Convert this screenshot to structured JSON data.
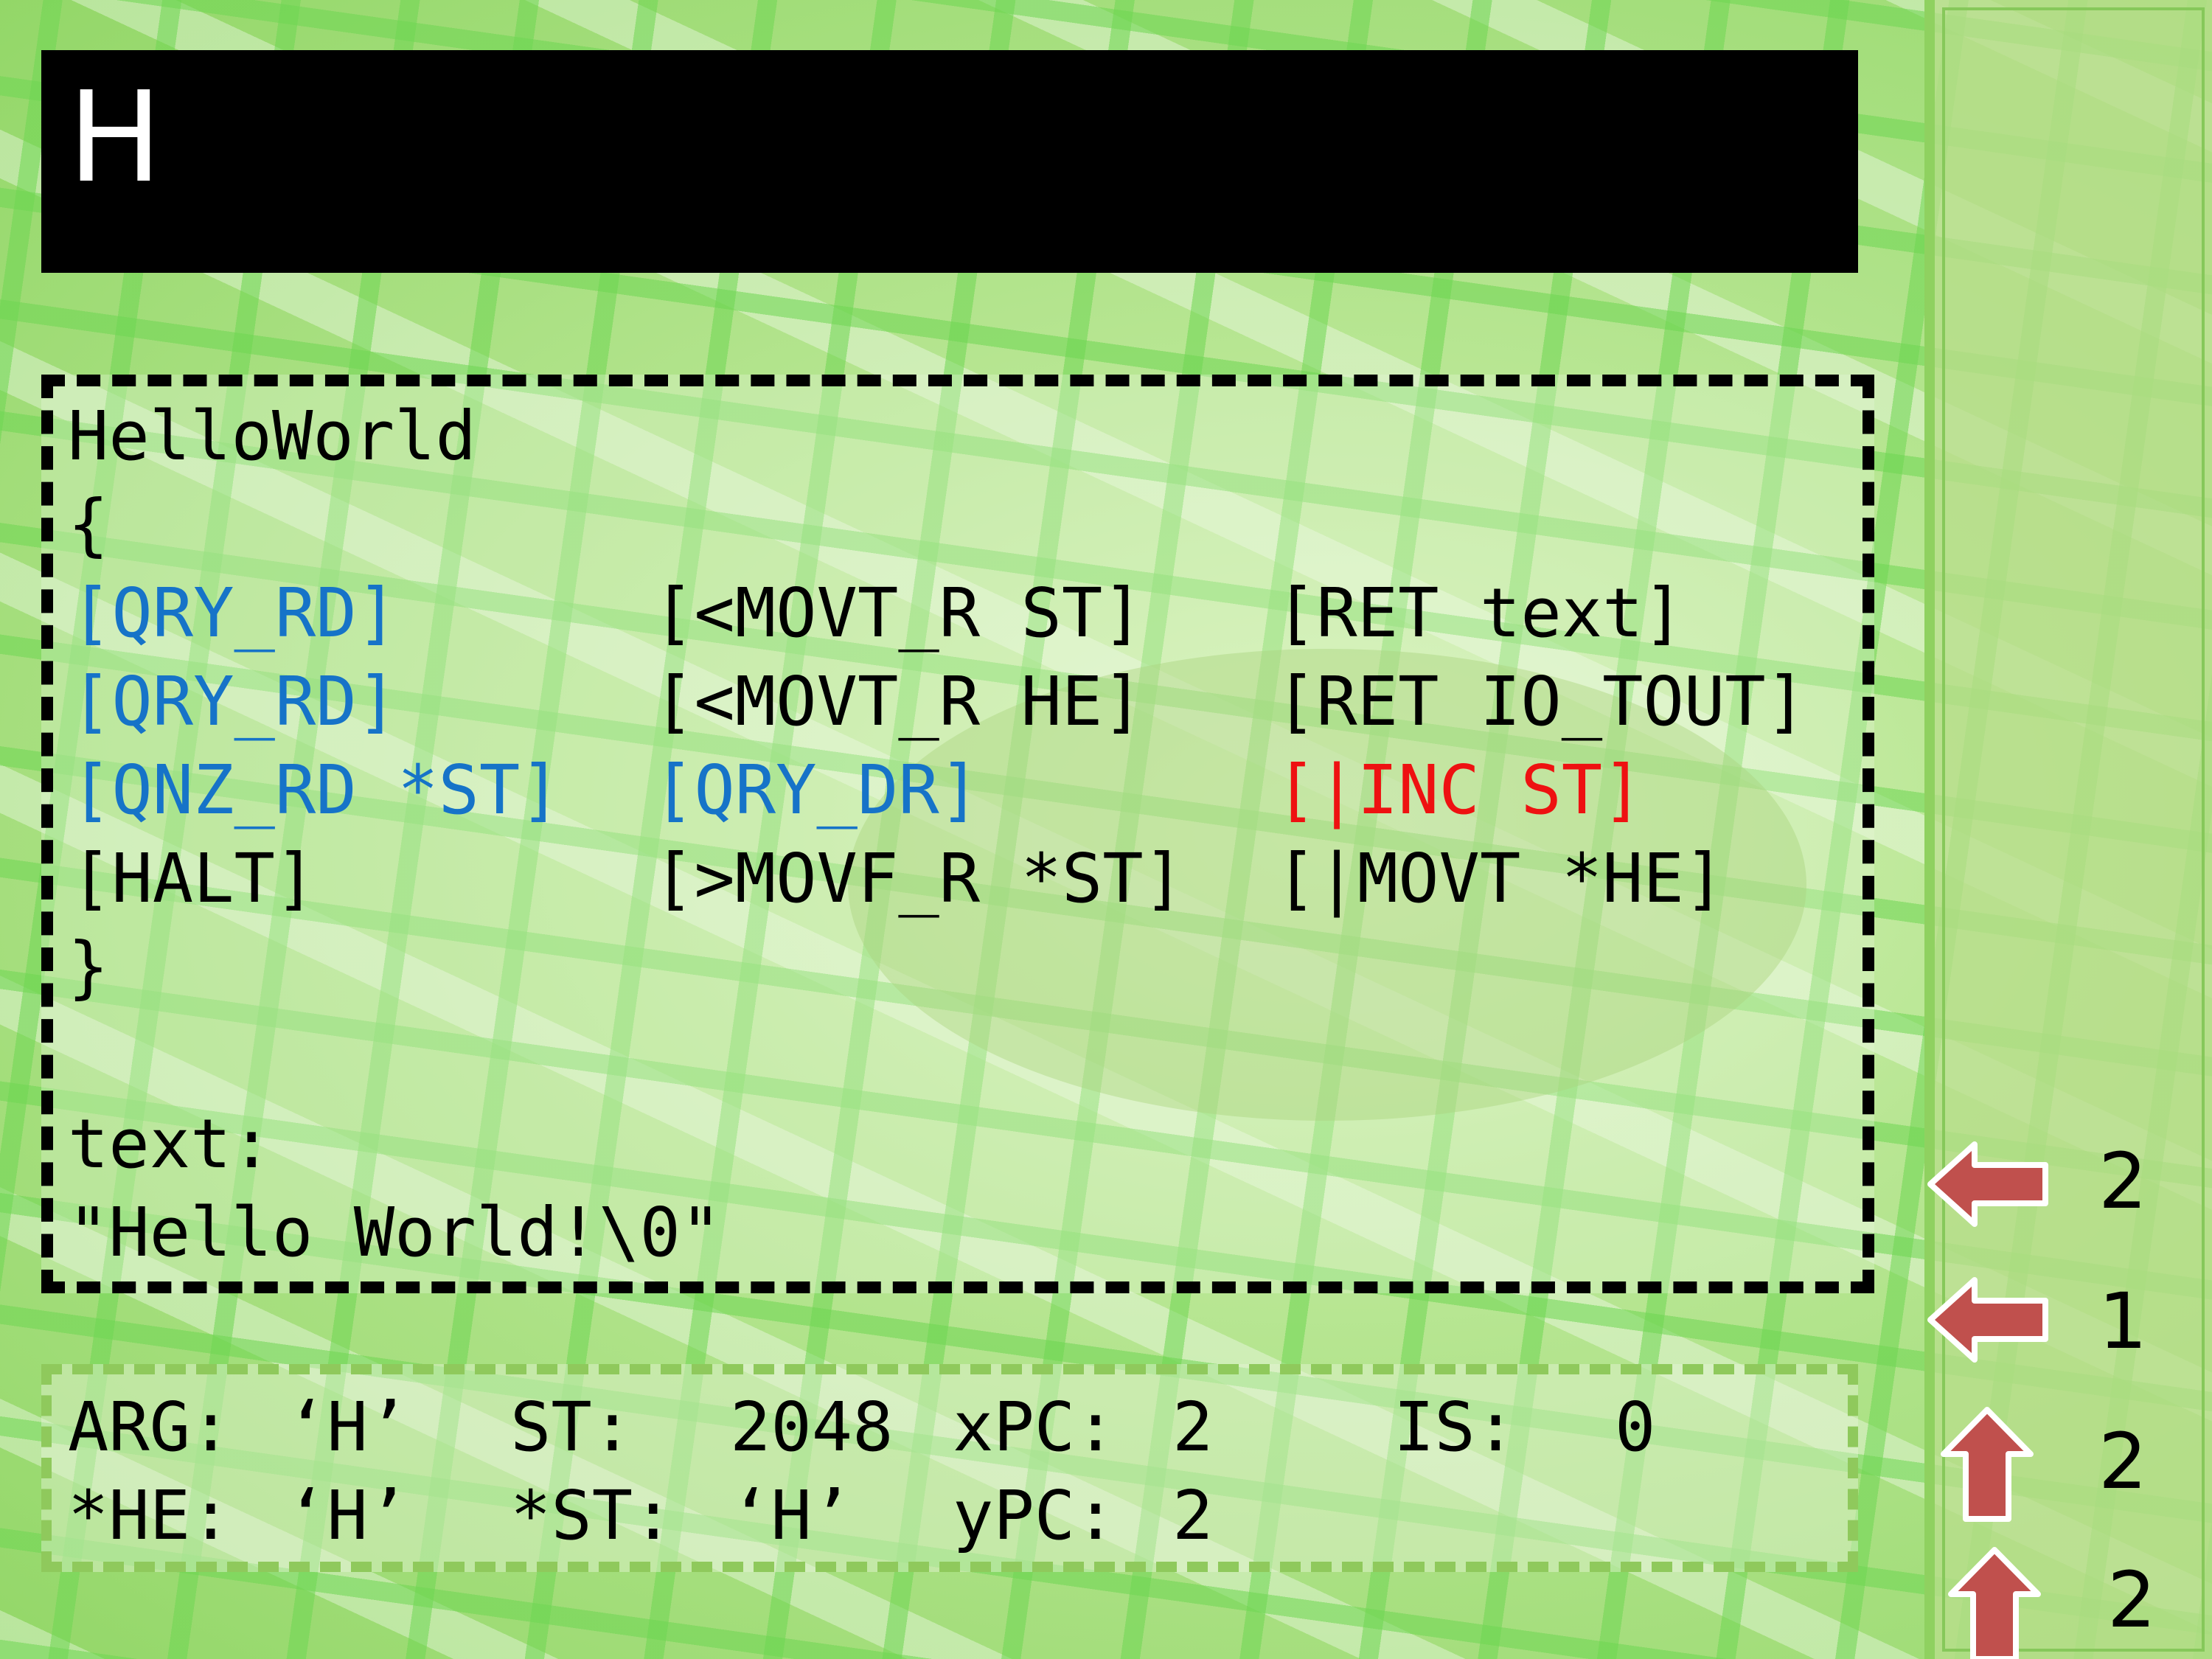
{
  "title": "H",
  "code": {
    "header": "HelloWorld",
    "open_brace": "{",
    "rows": [
      [
        "[QRY_RD]",
        "[<MOVT_R ST]",
        "[RET text]"
      ],
      [
        "[QRY_RD]",
        "[<MOVT_R HE]",
        "[RET IO_TOUT]"
      ],
      [
        "[QNZ_RD *ST]",
        "[QRY_DR]",
        "[|INC ST]"
      ],
      [
        "[HALT]",
        "[>MOVF_R *ST]",
        "[|MOVT *HE]"
      ]
    ],
    "close_brace": "}",
    "data_label": "text:",
    "data_value": "\"Hello World!\\0\""
  },
  "status": {
    "arg_label": "ARG:",
    "arg_value": "‘H’",
    "st_label": "ST:",
    "st_value": "2048",
    "xpc_label": "xPC:",
    "xpc_value": "2",
    "is_label": "IS:",
    "is_value": "0",
    "he_label": "*HE:",
    "he_value": "‘H’",
    "stp_label": "*ST:",
    "stp_value": "‘H’",
    "ypc_label": "yPC:",
    "ypc_value": "2"
  },
  "arrows": [
    {
      "icon": "left-arrow-icon",
      "count": "2"
    },
    {
      "icon": "left-arrow-icon",
      "count": "1"
    },
    {
      "icon": "up-arrow-icon",
      "count": "2"
    },
    {
      "icon": "up-arrow-icon",
      "count": "2"
    }
  ],
  "colors": {
    "highlight_blue": "#1673c8",
    "highlight_red": "#ee1111",
    "arrow_red": "#c0504d"
  }
}
